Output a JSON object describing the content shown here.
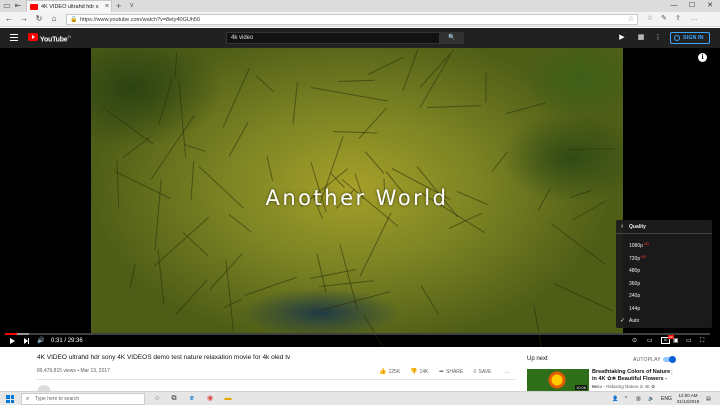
{
  "browser": {
    "tab_title": "4K VIDEO ultrahd hdr s",
    "url": "https://www.youtube.com/watch?v=8ety40GUh50",
    "new_tab": "+",
    "tab_list": "v"
  },
  "yt_header": {
    "logo_text": "YouTube",
    "logo_region": "IN",
    "search_query": "4k video",
    "sign_in": "SIGN IN"
  },
  "player": {
    "video_overlay_text": "Another World",
    "time_current": "0:31",
    "time_total": "29:36",
    "time_separator": "/",
    "progress_fraction": 0.0175,
    "buffer_fraction": 0.034,
    "hd_badge": "HD",
    "quality_menu": {
      "title": "Quality",
      "options": [
        {
          "label": "1080p",
          "badge": "HD"
        },
        {
          "label": "720p",
          "badge": "HD"
        },
        {
          "label": "480p",
          "badge": ""
        },
        {
          "label": "360p",
          "badge": ""
        },
        {
          "label": "240p",
          "badge": ""
        },
        {
          "label": "144p",
          "badge": ""
        },
        {
          "label": "Auto",
          "badge": ""
        }
      ],
      "selected": "Auto"
    }
  },
  "video_info": {
    "title": "4K VIDEO ultrahd hdr sony 4K VIDEOS demo test nature relaxation movie for 4k oled tv",
    "views": "89,479,815 views",
    "date": "Mar 13, 2017",
    "likes": "125K",
    "dislikes": "14K",
    "share": "SHARE",
    "save": "SAVE",
    "more": "..."
  },
  "up_next": {
    "heading": "Up next",
    "autoplay_label": "AUTOPLAY",
    "autoplay_on": true,
    "item": {
      "title": "Breathtaking Colors of Nature in 4K ✿❀ Beautiful Flowers - ...",
      "channel": "Baku - Relaxing Nature in 4K ✿",
      "duration": "10:06"
    }
  },
  "taskbar": {
    "search_placeholder": "Type here to search",
    "lang": "ENG",
    "time": "12:00 AM",
    "date": "31/12/2019"
  },
  "colors": {
    "yt_red": "#ff0000",
    "header_bg": "#212121",
    "link_blue": "#3ea6ff",
    "win_blue": "#0078d7"
  }
}
